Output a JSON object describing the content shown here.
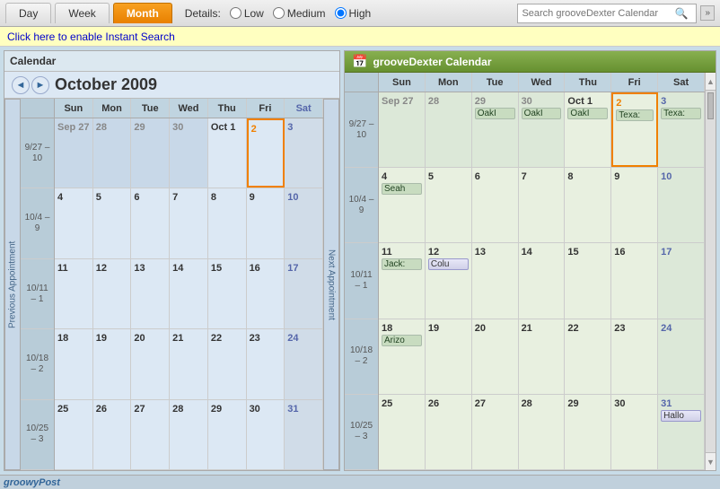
{
  "toolbar": {
    "tabs": [
      {
        "label": "Day",
        "active": false
      },
      {
        "label": "Week",
        "active": false
      },
      {
        "label": "Month",
        "active": true
      }
    ],
    "details_label": "Details:",
    "detail_options": [
      "Low",
      "Medium",
      "High"
    ],
    "search_placeholder": "Search grooveDexter Calendar",
    "expand_btn": "»"
  },
  "instant_search": {
    "text": "Click here to enable Instant Search"
  },
  "left_calendar": {
    "title": "Calendar",
    "nav_prev": "◄",
    "nav_next": "►",
    "month_title": "October 2009",
    "day_headers": [
      "Sun",
      "Mon",
      "Tue",
      "Wed",
      "Thu",
      "Fri",
      "Sat"
    ],
    "week_labels": [
      "9/27 – 10",
      "10/4 – 9",
      "10/11 – 1",
      "10/18 – 2",
      "10/25 – 3"
    ],
    "weeks": [
      [
        {
          "day": "Sep 27",
          "other": true
        },
        {
          "day": "28",
          "other": true
        },
        {
          "day": "29",
          "other": true
        },
        {
          "day": "30",
          "other": true
        },
        {
          "day": "Oct 1",
          "other": false
        },
        {
          "day": "2",
          "today": true
        },
        {
          "day": "3",
          "sat": true
        }
      ],
      [
        {
          "day": "4"
        },
        {
          "day": "5"
        },
        {
          "day": "6"
        },
        {
          "day": "7"
        },
        {
          "day": "8"
        },
        {
          "day": "9"
        },
        {
          "day": "10",
          "sat": true
        }
      ],
      [
        {
          "day": "11"
        },
        {
          "day": "12"
        },
        {
          "day": "13"
        },
        {
          "day": "14"
        },
        {
          "day": "15"
        },
        {
          "day": "16"
        },
        {
          "day": "17",
          "sat": true
        }
      ],
      [
        {
          "day": "18"
        },
        {
          "day": "19"
        },
        {
          "day": "20"
        },
        {
          "day": "21"
        },
        {
          "day": "22"
        },
        {
          "day": "23"
        },
        {
          "day": "24",
          "sat": true
        }
      ],
      [
        {
          "day": "25"
        },
        {
          "day": "26"
        },
        {
          "day": "27"
        },
        {
          "day": "28"
        },
        {
          "day": "29"
        },
        {
          "day": "30"
        },
        {
          "day": "31",
          "sat": true
        }
      ]
    ],
    "prev_appt": "Previous Appointment",
    "next_appt": "Next Appointment"
  },
  "right_calendar": {
    "title": "grooveDexter Calendar",
    "day_headers": [
      "Sun",
      "Mon",
      "Tue",
      "Wed",
      "Thu",
      "Fri",
      "Sat"
    ],
    "week_labels": [
      "9/27 – 10",
      "10/4 – 9",
      "10/11 – 1",
      "10/18 – 2",
      "10/25 – 3"
    ],
    "weeks": [
      [
        {
          "day": "Sep 27",
          "other": true,
          "events": []
        },
        {
          "day": "28",
          "other": true,
          "events": []
        },
        {
          "day": "29",
          "other": true,
          "events": [
            "OakI"
          ]
        },
        {
          "day": "30",
          "other": true,
          "events": [
            "OakI"
          ]
        },
        {
          "day": "Oct 1",
          "events": [
            "OakI"
          ]
        },
        {
          "day": "2",
          "today": true,
          "events": [
            "Texa:"
          ]
        },
        {
          "day": "3",
          "sat": true,
          "events": [
            "Texa:"
          ]
        }
      ],
      [
        {
          "day": "4",
          "events": [
            "Seah"
          ]
        },
        {
          "day": "5",
          "events": []
        },
        {
          "day": "6",
          "events": []
        },
        {
          "day": "7",
          "events": []
        },
        {
          "day": "8",
          "events": []
        },
        {
          "day": "9",
          "events": []
        },
        {
          "day": "10",
          "sat": true,
          "events": []
        }
      ],
      [
        {
          "day": "11",
          "events": [
            "Jack:"
          ]
        },
        {
          "day": "12",
          "events": [
            "Colu"
          ]
        },
        {
          "day": "13",
          "events": []
        },
        {
          "day": "14",
          "events": []
        },
        {
          "day": "15",
          "events": []
        },
        {
          "day": "16",
          "events": []
        },
        {
          "day": "17",
          "sat": true,
          "events": []
        }
      ],
      [
        {
          "day": "18",
          "events": [
            "Arizo"
          ]
        },
        {
          "day": "19",
          "events": []
        },
        {
          "day": "20",
          "events": []
        },
        {
          "day": "21",
          "events": []
        },
        {
          "day": "22",
          "events": []
        },
        {
          "day": "23",
          "events": []
        },
        {
          "day": "24",
          "sat": true,
          "events": []
        }
      ],
      [
        {
          "day": "25",
          "events": []
        },
        {
          "day": "26",
          "events": []
        },
        {
          "day": "27",
          "events": []
        },
        {
          "day": "28",
          "events": []
        },
        {
          "day": "29",
          "events": []
        },
        {
          "day": "30",
          "events": []
        },
        {
          "day": "31",
          "sat": true,
          "events": [
            "Hallo"
          ]
        }
      ]
    ]
  },
  "bottom_bar": {
    "brand": "groowyPost"
  }
}
